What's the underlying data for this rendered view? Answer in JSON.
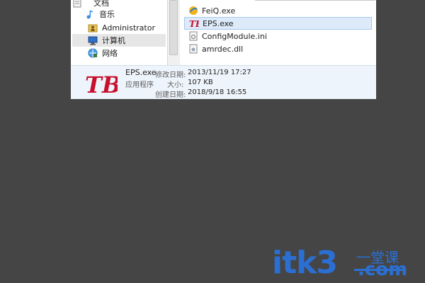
{
  "nav": {
    "items": [
      {
        "label": "文档",
        "icon": "document-icon"
      },
      {
        "label": "音乐",
        "icon": "music-icon"
      },
      {
        "label": "Administrator",
        "icon": "user-folder-icon"
      },
      {
        "label": "计算机",
        "icon": "computer-icon",
        "selected": true
      },
      {
        "label": "网络",
        "icon": "network-icon"
      }
    ]
  },
  "files": [
    {
      "name": "FeiQ.exe",
      "icon": "feiq-app-icon"
    },
    {
      "name": "EPS.exe",
      "icon": "eps-app-icon",
      "selected": true
    },
    {
      "name": "ConfigModule.ini",
      "icon": "ini-file-icon"
    },
    {
      "name": "amrdec.dll",
      "icon": "dll-file-icon"
    }
  ],
  "details": {
    "name": "EPS.exe",
    "type": "应用程序",
    "modified_label": "修改日期:",
    "modified_value": "2013/11/19 17:27",
    "size_label": "大小:",
    "size_value": "107 KB",
    "created_label": "创建日期:",
    "created_value": "2018/9/18 16:55"
  },
  "watermark": {
    "main": "itk3",
    "suffix": "一堂课",
    "dotcom": ".com"
  },
  "colors": {
    "eps_red": "#c8102e",
    "selection": "#dceafa",
    "watermark": "#2b6fd3"
  }
}
